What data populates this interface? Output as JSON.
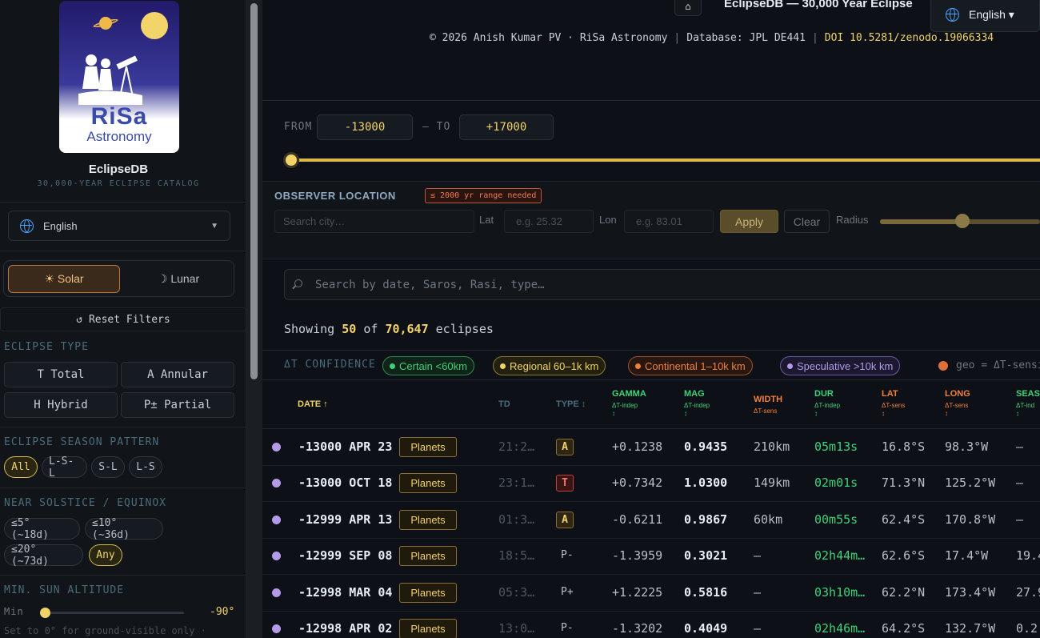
{
  "sidebar": {
    "logo_text_1": "RiSa",
    "logo_text_2": "Astronomy",
    "app_name": "EclipseDB",
    "app_subtitle": "30,000-YEAR ECLIPSE CATALOG",
    "language": "English",
    "mode_solar": "☀ Solar",
    "mode_lunar": "☽ Lunar",
    "reset": "↺ Reset Filters",
    "eclipse_type_label": "ECLIPSE TYPE",
    "types": [
      "T Total",
      "A Annular",
      "H Hybrid",
      "P± Partial"
    ],
    "season_label": "ECLIPSE SEASON PATTERN",
    "season_options": [
      "All",
      "L-S-L",
      "S-L",
      "L-S"
    ],
    "solstice_label": "NEAR SOLSTICE / EQUINOX",
    "solstice_options": [
      "≤5° (~18d)",
      "≤10° (~36d)",
      "≤20° (~73d)",
      "Any"
    ],
    "sun_alt_label": "MIN. SUN ALTITUDE",
    "sun_alt_min_label": "Min",
    "sun_alt_value": "-90°",
    "sun_alt_hint": "Set to 0° for ground-visible only ·"
  },
  "header": {
    "home_icon": "⌂",
    "title": "EclipseDB — 30,000 Year Eclipse",
    "language": "English ▾",
    "credit": "© 2026 Anish Kumar PV · RiSa Astronomy",
    "database": "Database: JPL DE441",
    "doi": "DOI 10.5281/zenodo.19066334"
  },
  "range": {
    "from_label": "FROM",
    "from_value": "-13000",
    "to_label": "— TO",
    "to_value": "+17000"
  },
  "observer": {
    "title": "OBSERVER LOCATION",
    "badge": "≤ 2000 yr range needed",
    "city_placeholder": "Search city…",
    "lat_label": "Lat",
    "lat_placeholder": "e.g. 25.32",
    "lon_label": "Lon",
    "lon_placeholder": "e.g. 83.01",
    "apply": "Apply",
    "clear": "Clear",
    "radius_label": "Radius"
  },
  "search": {
    "placeholder": "Search by date, Saros, Rasi, type…"
  },
  "summary": {
    "prefix": "Showing",
    "shown": "50",
    "of": "of",
    "total": "70,647",
    "suffix": "eclipses"
  },
  "confidence": {
    "label": "ΔT CONFIDENCE",
    "chips": [
      {
        "text": "Certain <60km",
        "color": "#3fd17a"
      },
      {
        "text": "Regional 60–1k km",
        "color": "#f1d36a"
      },
      {
        "text": "Continental 1–10k km",
        "color": "#f0803a"
      },
      {
        "text": "Speculative >10k km",
        "color": "#b49ae8"
      }
    ],
    "geo_note": "geo = ΔT-sensi"
  },
  "table": {
    "headers": {
      "date": "DATE ↑",
      "td": "TD",
      "type": "TYPE ↕",
      "gamma": "GAMMA",
      "gamma_sub": "ΔT-indep",
      "mag": "MAG",
      "mag_sub": "ΔT-indep",
      "width": "WIDTH",
      "width_sub": "ΔT-sens",
      "dur": "DUR",
      "dur_sub": "ΔT-indep",
      "lat": "LAT",
      "lat_sub": "ΔT-sens",
      "long": "LONG",
      "long_sub": "ΔT-sens",
      "season": "SEAS",
      "season_sub": "ΔT-ind",
      "sort": "↕"
    },
    "tag": "Planets",
    "rows": [
      {
        "date": "-13000 APR 23",
        "td": "21:2…",
        "type": "A",
        "gamma": "+0.1238",
        "mag": "0.9435",
        "width": "210km",
        "dur": "05m13s",
        "lat": "16.8°S",
        "long": "98.3°W",
        "season": "—"
      },
      {
        "date": "-13000 OCT 18",
        "td": "23:1…",
        "type": "T",
        "gamma": "+0.7342",
        "mag": "1.0300",
        "width": "149km",
        "dur": "02m01s",
        "lat": "71.3°N",
        "long": "125.2°W",
        "season": "—"
      },
      {
        "date": "-12999 APR 13",
        "td": "01:3…",
        "type": "A",
        "gamma": "-0.6211",
        "mag": "0.9867",
        "width": "60km",
        "dur": "00m55s",
        "lat": "62.4°S",
        "long": "170.8°W",
        "season": "—"
      },
      {
        "date": "-12999 SEP 08",
        "td": "18:5…",
        "type": "P-",
        "gamma": "-1.3959",
        "mag": "0.3021",
        "width": "—",
        "dur": "02h44m…",
        "lat": "62.6°S",
        "long": "17.4°W",
        "season": "19.4"
      },
      {
        "date": "-12998 MAR 04",
        "td": "05:3…",
        "type": "P+",
        "gamma": "+1.2225",
        "mag": "0.5816",
        "width": "—",
        "dur": "03h10m…",
        "lat": "62.2°N",
        "long": "173.4°W",
        "season": "27.9"
      },
      {
        "date": "-12998 APR 02",
        "td": "13:0…",
        "type": "P-",
        "gamma": "-1.3202",
        "mag": "0.4049",
        "width": "—",
        "dur": "02h46m…",
        "lat": "64.2°S",
        "long": "132.7°W",
        "season": "0.2"
      }
    ]
  }
}
